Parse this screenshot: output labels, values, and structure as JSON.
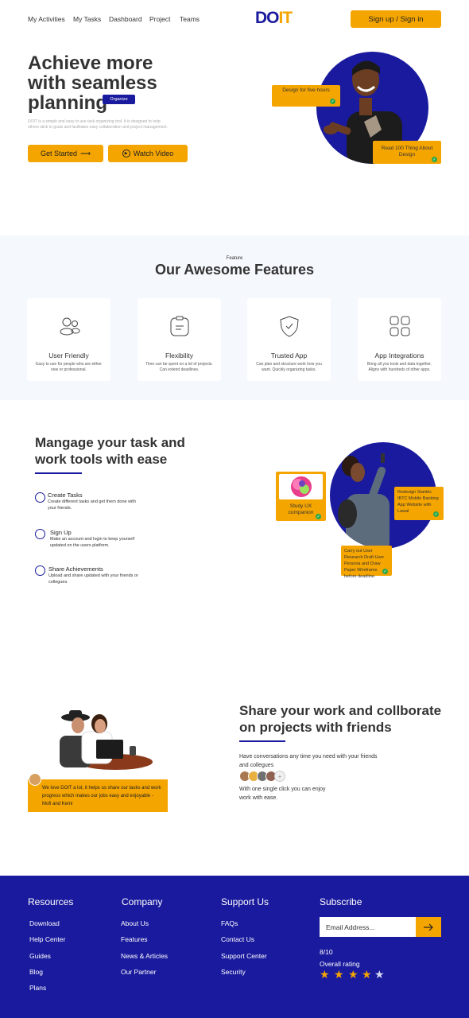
{
  "nav": {
    "items": [
      "My Activities",
      "My Tasks",
      "Dashboard",
      "Project",
      "Teams"
    ],
    "logo_main": "DO",
    "logo_accent": "IT",
    "signup_label": "Sign up / Sign in"
  },
  "hero": {
    "title": "Achieve more with seamless planning",
    "tag": "Organize",
    "description": "DOIT is a simple and easy to use task organizing tool. It is designed to help others stick to goals and facilitates easy collaboration and project management.",
    "get_started": "Get Started",
    "watch_video": "Watch Video",
    "card1": "Design for five hours",
    "card2": "Read 100 Thing About Design"
  },
  "features": {
    "label": "Feature",
    "title": "Our Awesome Features",
    "items": [
      {
        "name": "User Friendly",
        "desc": "Easy to use for people who are either new or professional."
      },
      {
        "name": "Flexibility",
        "desc": "Time can be spent on a lot of projects. Can extend deadlines."
      },
      {
        "name": "Trusted App",
        "desc": "Can plan and structure work how you want. Quickly organizing tasks."
      },
      {
        "name": "App Integrations",
        "desc": "Bring all you tools and data together. Aligns with hundreds of other apps."
      }
    ]
  },
  "manage": {
    "title": "Mangage your task and work tools with ease",
    "tasks": [
      {
        "name": "Create Tasks",
        "desc": "Create different tasks and get them done with your friends."
      },
      {
        "name": "Sign Up",
        "desc": "Make an account and login to keep yourself updated on the users platform."
      },
      {
        "name": "Share Achievements",
        "desc": "Upload and share  updated with your friends or collegues."
      }
    ],
    "card_study": "Study UX companion",
    "card_redesign": "Redesign Stanbic IBTC Mobile Banking App Website with Lawal",
    "card_research": "Carry out User Research Draft User Persona and Draw Paper Wireframe before deadline."
  },
  "share": {
    "title": "Share your work and collborate on projects with friends",
    "text1": "Have conversations any time you need with your friends and collegues",
    "text2": "With one single click you can enjoy work with ease.",
    "add_symbol": "+",
    "quote": "We love DOIT a lot, it helps us share our tasks and work progress which makes our jobs easy and enjoyable    - Mofi and Kemi"
  },
  "footer": {
    "resources": {
      "title": "Resources",
      "links": [
        "Download",
        "Help Center",
        "Guides",
        "Blog",
        "Plans"
      ]
    },
    "company": {
      "title": "Company",
      "links": [
        "About Us",
        "Features",
        "News & Articles",
        "Our Partner"
      ]
    },
    "support": {
      "title": "Support Us",
      "links": [
        "FAQs",
        "Contact Us",
        "Support Center",
        "Security"
      ]
    },
    "subscribe": {
      "title": "Subscribe",
      "placeholder": "Email Address...",
      "rating": "8/10",
      "rating_label": "Overall rating",
      "stars": 4
    }
  },
  "colors": {
    "brand_blue": "#1a1a9e",
    "accent_orange": "#f5a500",
    "check_green": "#2aa84a"
  }
}
